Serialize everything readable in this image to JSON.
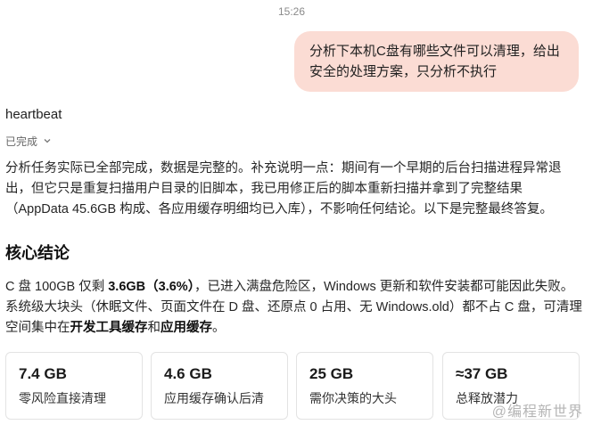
{
  "timestamp": "15:26",
  "user_message": "分析下本机C盘有哪些文件可以清理，给出安全的处理方案，只分析不执行",
  "assistant": {
    "name": "heartbeat",
    "status": "已完成",
    "status_icon": "chevron-down-icon"
  },
  "intro": {
    "text": "分析任务实际已全部完成，数据是完整的。补充说明一点：期间有一个早期的后台扫描进程异常退出，但它只是重复扫描用户目录的旧脚本，我已用修正后的脚本重新扫描并拿到了完整结果（AppData 45.6GB 构成、各应用缓存明细均已入库），不影响任何结论。以下是完整最终答复。"
  },
  "section": {
    "heading": "核心结论",
    "p_a": "C 盘 100GB 仅剩 ",
    "p_b_bold": "3.6GB（3.6%）",
    "p_c": "，已进入满盘危险区，Windows 更新和软件安装都可能因此失败。系统级大块头（休眠文件、页面文件在 D 盘、还原点 0 占用、无 Windows.old）都不占 C 盘，可清理空间集中在",
    "p_d_bold": "开发工具缓存",
    "p_e": "和",
    "p_f_bold": "应用缓存",
    "p_g": "。"
  },
  "cards": [
    {
      "value": "7.4 GB",
      "label": "零风险直接清理"
    },
    {
      "value": "4.6 GB",
      "label": "应用缓存确认后清"
    },
    {
      "value": "25 GB",
      "label": "需你决策的大头"
    },
    {
      "value": "≈37 GB",
      "label": "总释放潜力"
    }
  ],
  "watermark": "@编程新世界"
}
